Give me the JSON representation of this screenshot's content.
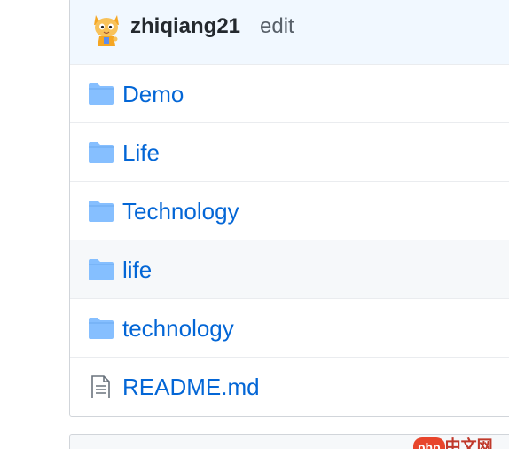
{
  "commit": {
    "author": "zhiqiang21",
    "action": "edit",
    "avatar_icon": "cat-avatar-icon"
  },
  "files": [
    {
      "name": "Demo",
      "type": "folder",
      "icon": "folder-icon"
    },
    {
      "name": "Life",
      "type": "folder",
      "icon": "folder-icon"
    },
    {
      "name": "Technology",
      "type": "folder",
      "icon": "folder-icon"
    },
    {
      "name": "life",
      "type": "folder",
      "icon": "folder-icon",
      "hovered": true
    },
    {
      "name": "technology",
      "type": "folder",
      "icon": "folder-icon"
    },
    {
      "name": "README.md",
      "type": "file",
      "icon": "file-text-icon"
    }
  ],
  "watermark": {
    "badge": "php",
    "text": "中文网"
  },
  "colors": {
    "link": "#0366d6",
    "folder": "#79b8ff",
    "commit_bg": "#f1f8ff"
  }
}
